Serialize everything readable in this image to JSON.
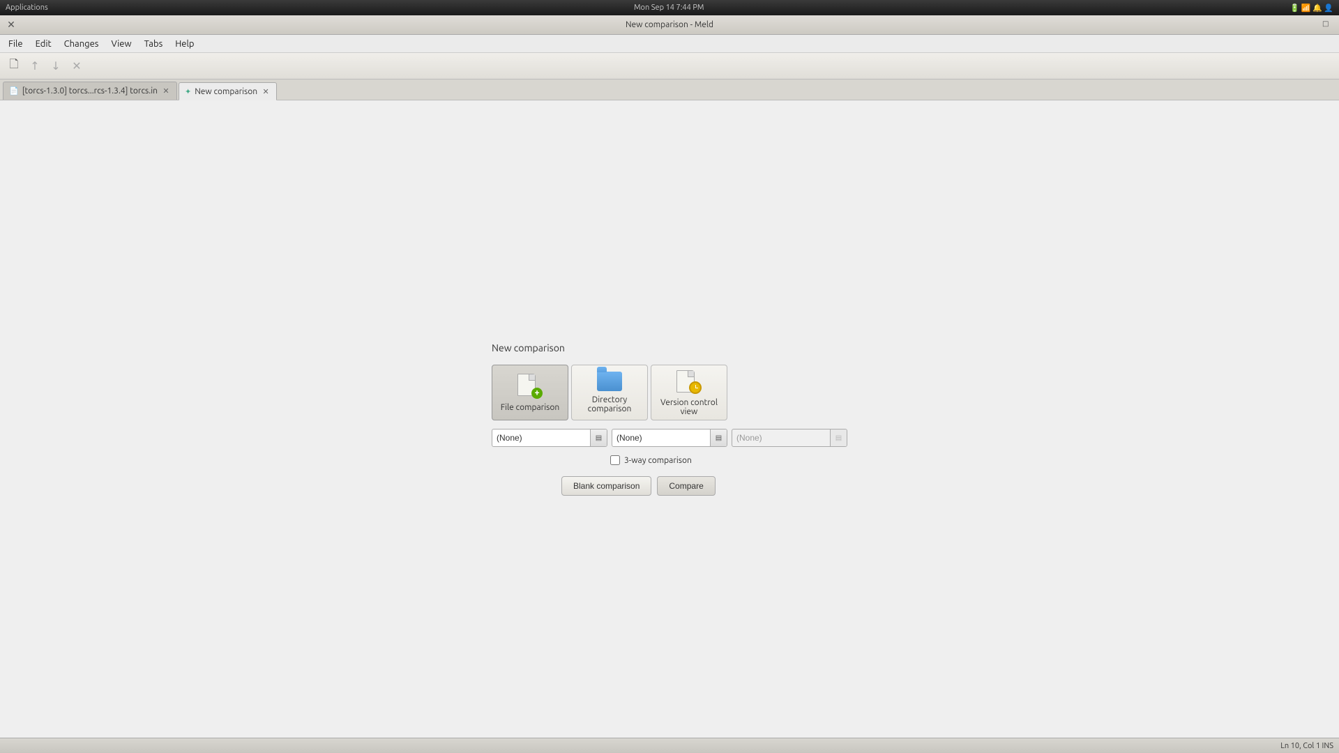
{
  "system_bar": {
    "left": "Applications",
    "center": "Mon Sep 14   7:44 PM",
    "right": "icons"
  },
  "window": {
    "title": "New comparison - Meld",
    "close_btn": "✕",
    "expand_btn": "□"
  },
  "menu": {
    "items": [
      "File",
      "Edit",
      "Changes",
      "View",
      "Tabs",
      "Help"
    ]
  },
  "toolbar": {
    "buttons": [
      {
        "name": "new-file",
        "icon": "🗋"
      },
      {
        "name": "prev-change",
        "icon": "↑"
      },
      {
        "name": "next-change",
        "icon": "↓"
      },
      {
        "name": "stop",
        "icon": "✕"
      }
    ]
  },
  "tabs": [
    {
      "id": "torcs-tab",
      "label": "[torcs-1.3.0] torcs...rcs-1.3.4] torcs.in",
      "active": false,
      "icon": "📄"
    },
    {
      "id": "new-comparison-tab",
      "label": "New comparison",
      "active": true,
      "icon": "✦"
    }
  ],
  "comparison_panel": {
    "title": "New comparison",
    "types": [
      {
        "id": "file-comparison",
        "label": "File comparison",
        "active": true
      },
      {
        "id": "directory-comparison",
        "label": "Directory comparison",
        "active": false
      },
      {
        "id": "version-control-view",
        "label": "Version control view",
        "active": false
      }
    ],
    "inputs": [
      {
        "placeholder": "(None)",
        "value": "(None)",
        "disabled": false
      },
      {
        "placeholder": "(None)",
        "value": "(None)",
        "disabled": false
      },
      {
        "placeholder": "(None)",
        "value": "(None)",
        "disabled": true
      }
    ],
    "three_way_label": "3-way comparison",
    "blank_btn": "Blank comparison",
    "compare_btn": "Compare"
  },
  "status_bar": {
    "text": "Ln 10, Col 1  INS"
  }
}
